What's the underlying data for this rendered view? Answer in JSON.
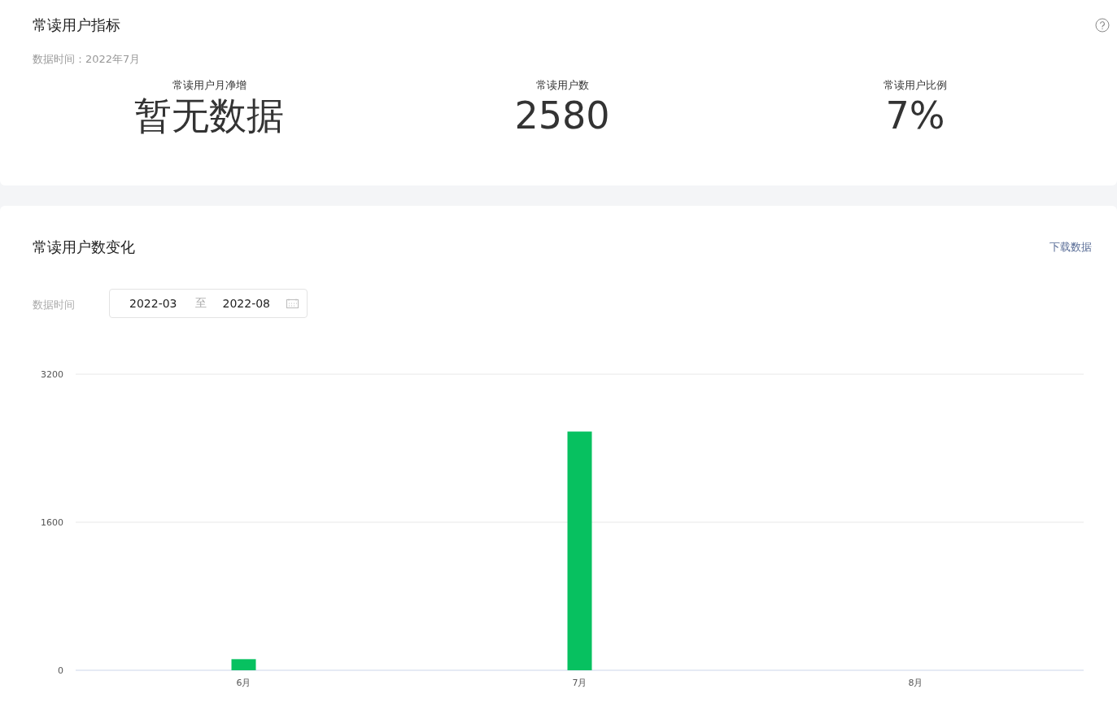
{
  "summary": {
    "title": "常读用户指标",
    "data_time": "数据时间：2022年7月",
    "metrics": [
      {
        "label": "常读用户月净增",
        "value": "暂无数据"
      },
      {
        "label": "常读用户数",
        "value": "2580"
      },
      {
        "label": "常读用户比例",
        "value": "7%"
      }
    ]
  },
  "trend": {
    "title": "常读用户数变化",
    "download": "下载数据",
    "filter": {
      "label": "数据时间",
      "start": "2022-03",
      "separator": "至",
      "end": "2022-08"
    },
    "chart_data": {
      "type": "bar",
      "categories": [
        "6月",
        "7月",
        "8月"
      ],
      "series": [
        {
          "color": "#07c160",
          "values": [
            120,
            2580,
            0
          ]
        }
      ],
      "ylim": [
        0,
        3200
      ],
      "yticks": [
        0,
        1600,
        3200
      ]
    }
  }
}
